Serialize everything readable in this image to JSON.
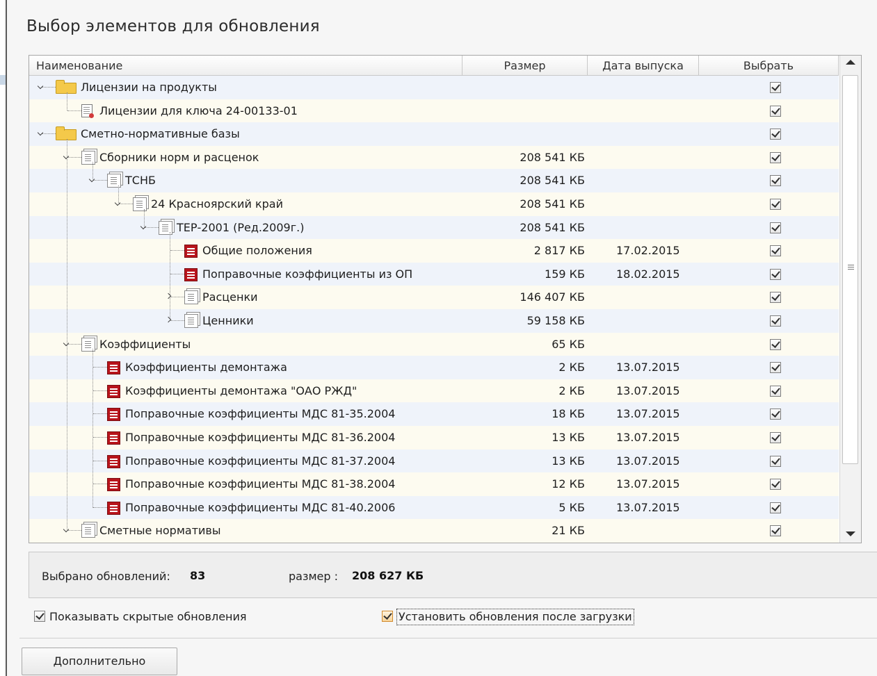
{
  "dialog": {
    "title": "Выбор элементов для обновления"
  },
  "tree": {
    "columns": {
      "name": "Наименование",
      "size": "Размер",
      "date": "Дата выпуска",
      "select": "Выбрать"
    },
    "rows": [
      {
        "level": 0,
        "icon": "folder-icon",
        "expander": "expanded",
        "name": "Лицензии на продукты",
        "size": "",
        "date": "",
        "checked": true
      },
      {
        "level": 1,
        "icon": "license-doc-icon",
        "expander": "none",
        "name": "Лицензии для ключа 24-00133-01",
        "size": "",
        "date": "",
        "checked": true
      },
      {
        "level": 0,
        "icon": "folder-icon",
        "expander": "expanded",
        "name": "Сметно-нормативные базы",
        "size": "",
        "date": "",
        "checked": true
      },
      {
        "level": 1,
        "icon": "document-stack-icon",
        "expander": "expanded",
        "name": "Сборники норм и расценок",
        "size": "208 541 КБ",
        "date": "",
        "checked": true
      },
      {
        "level": 2,
        "icon": "document-stack-icon",
        "expander": "expanded",
        "name": "ТСНБ",
        "size": "208 541 КБ",
        "date": "",
        "checked": true
      },
      {
        "level": 3,
        "icon": "document-stack-icon",
        "expander": "expanded",
        "name": "24 Красноярский край",
        "size": "208 541 КБ",
        "date": "",
        "checked": true
      },
      {
        "level": 4,
        "icon": "document-stack-icon",
        "expander": "expanded",
        "name": "ТЕР-2001 (Ред.2009г.)",
        "size": "208 541 КБ",
        "date": "",
        "checked": true
      },
      {
        "level": 5,
        "icon": "red-document-icon",
        "expander": "none",
        "name": "Общие положения",
        "size": "2 817 КБ",
        "date": "17.02.2015",
        "checked": true
      },
      {
        "level": 5,
        "icon": "red-document-icon",
        "expander": "none",
        "name": "Поправочные коэффициенты из ОП",
        "size": "159 КБ",
        "date": "18.02.2015",
        "checked": true
      },
      {
        "level": 5,
        "icon": "document-stack-icon",
        "expander": "collapsed",
        "name": "Расценки",
        "size": "146 407 КБ",
        "date": "",
        "checked": true
      },
      {
        "level": 5,
        "icon": "document-stack-icon",
        "expander": "collapsed",
        "name": "Ценники",
        "size": "59 158 КБ",
        "date": "",
        "checked": true
      },
      {
        "level": 1,
        "icon": "document-stack-icon",
        "expander": "expanded",
        "name": "Коэффициенты",
        "size": "65 КБ",
        "date": "",
        "checked": true
      },
      {
        "level": 2,
        "icon": "red-document-icon",
        "expander": "none",
        "name": "Коэффициенты демонтажа",
        "size": "2 КБ",
        "date": "13.07.2015",
        "checked": true
      },
      {
        "level": 2,
        "icon": "red-document-icon",
        "expander": "none",
        "name": "Коэффициенты демонтажа \"ОАО РЖД\"",
        "size": "2 КБ",
        "date": "13.07.2015",
        "checked": true
      },
      {
        "level": 2,
        "icon": "red-document-icon",
        "expander": "none",
        "name": "Поправочные коэффициенты МДС 81-35.2004",
        "size": "18 КБ",
        "date": "13.07.2015",
        "checked": true
      },
      {
        "level": 2,
        "icon": "red-document-icon",
        "expander": "none",
        "name": "Поправочные коэффициенты МДС 81-36.2004",
        "size": "13 КБ",
        "date": "13.07.2015",
        "checked": true
      },
      {
        "level": 2,
        "icon": "red-document-icon",
        "expander": "none",
        "name": "Поправочные коэффициенты МДС 81-37.2004",
        "size": "13 КБ",
        "date": "13.07.2015",
        "checked": true
      },
      {
        "level": 2,
        "icon": "red-document-icon",
        "expander": "none",
        "name": "Поправочные коэффициенты МДС 81-38.2004",
        "size": "12 КБ",
        "date": "13.07.2015",
        "checked": true
      },
      {
        "level": 2,
        "icon": "red-document-icon",
        "expander": "none",
        "name": "Поправочные коэффициенты МДС 81-40.2006",
        "size": "5 КБ",
        "date": "13.07.2015",
        "checked": true
      },
      {
        "level": 1,
        "icon": "document-stack-icon",
        "expander": "expanded",
        "name": "Сметные нормативы",
        "size": "21 КБ",
        "date": "",
        "checked": true
      }
    ]
  },
  "summary": {
    "count_label": "Выбрано обновлений:",
    "count_value": "83",
    "size_label": "размер :",
    "size_value": "208 627 КБ"
  },
  "options": {
    "show_hidden": {
      "label": "Показывать скрытые обновления",
      "checked": true
    },
    "install_after": {
      "label": "Установить обновления после загрузки",
      "checked": true
    }
  },
  "buttons": {
    "more": "Дополнительно"
  }
}
